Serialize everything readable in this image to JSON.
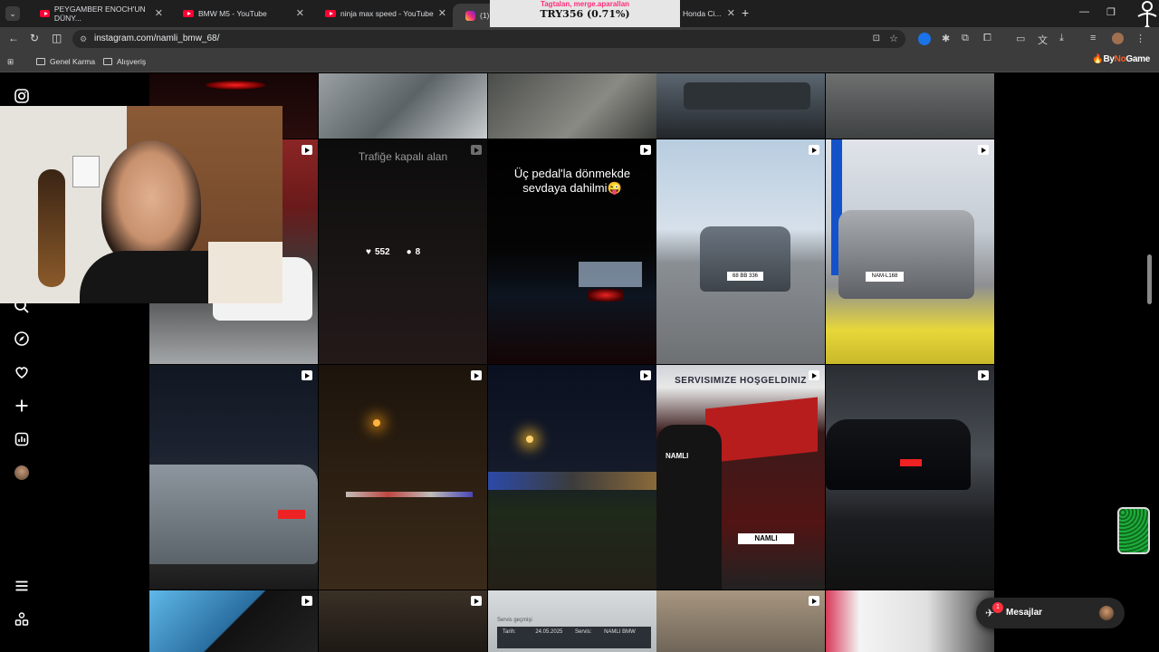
{
  "tabs": [
    {
      "title": "PEYGAMBER ENOCH'UN DÜNY...",
      "icon": "youtube"
    },
    {
      "title": "BMW M5 - YouTube",
      "icon": "youtube"
    },
    {
      "title": "ninja max speed - YouTube",
      "icon": "youtube"
    },
    {
      "title": "(1) Ins",
      "icon": "instagram",
      "active": true
    },
    {
      "title": "Honda Ci...",
      "icon": "youtube"
    }
  ],
  "stream_overlay": {
    "top_text": "Tagtalan, merge.aparallan",
    "price_text": "TRY356 (0.71%)"
  },
  "address": {
    "url": "instagram.com/namli_bmw_68/"
  },
  "bookmarks": [
    {
      "label": "Genel Karma"
    },
    {
      "label": "Alışveriş"
    }
  ],
  "bynogame": {
    "by": "By",
    "no": "No",
    "game": "Game"
  },
  "posts": {
    "row2": {
      "p2_overlay": "Trafiğe kapalı alan",
      "p2_likes": "552",
      "p2_comments": "8",
      "p3_caption": "Üç pedal'la dönmekde sevdaya dahilmi😜"
    },
    "row3": {
      "p4_sign": "SERVISIMIZE HOŞGELDINIZ",
      "p4_shirt": "NAMLI",
      "p4_plate": "NAMLI"
    },
    "row2_plates": {
      "p4": "68 BB 336",
      "p5": "NAM-L168"
    },
    "row4": {
      "p3_line1": "Servis geçmişi",
      "p3_date_label": "Tarih:",
      "p3_date": "24.05.2025",
      "p3_service_label": "Servis:",
      "p3_service": "NAMLI BMW"
    }
  },
  "messages": {
    "label": "Mesajlar",
    "badge": "1"
  },
  "colors": {
    "accent_like": "#ffffff",
    "badge": "#ff3040",
    "youtube": "#ff0033",
    "overlay_pink": "#ff2d7a"
  }
}
